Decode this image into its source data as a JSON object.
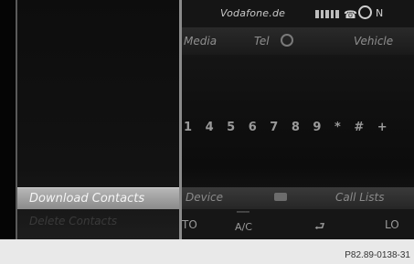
{
  "status_bar": {
    "carrier": "Vodafone.de",
    "compass_label": "N",
    "icons": [
      "signal-strength-icon",
      "handset-icon",
      "compass-icon"
    ]
  },
  "main_tabs": {
    "media": "Media",
    "tel": "Tel",
    "vehicle": "Vehicle"
  },
  "dial": {
    "digits": "1 4 5 6 7 8 9 * # +"
  },
  "menu": {
    "active_item": "Download Contacts",
    "disabled_item": "Delete Contacts"
  },
  "softkeys": {
    "device": "Device",
    "call_lists": "Call Lists"
  },
  "climate": {
    "auto": "TO",
    "ac": "A/C",
    "lo": "LO"
  },
  "footer": {
    "code": "P82.89-0138-31"
  }
}
